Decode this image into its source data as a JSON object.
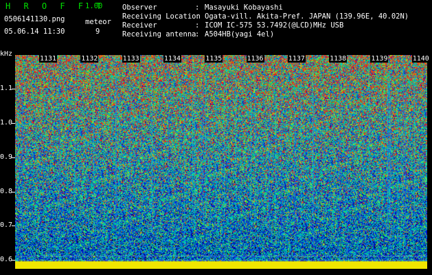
{
  "header": {
    "app_name": "H R O F F T",
    "version": "1.00",
    "filename": "0506141130.png",
    "meteor_label": "meteor",
    "datetime": "05.06.14 11:30",
    "meteor_count": "9"
  },
  "station": {
    "rows": [
      {
        "label": "Observer",
        "value": "Masayuki Kobayashi"
      },
      {
        "label": "Receiving Location",
        "value": "Ogata-vill. Akita-Pref. JAPAN (139.96E, 40.02N)"
      },
      {
        "label": "Receiver",
        "value": "ICOM IC-575 53.7492(@LCD)MHz USB"
      },
      {
        "label": "Receiving antenna",
        "value": "A504HB(yagi 4el)"
      }
    ],
    "separator": ":"
  },
  "spectrogram": {
    "y_unit": "kHz",
    "y_ticks": [
      "1.1",
      "1.0",
      "0.9",
      "0.8",
      "0.7",
      "0.6"
    ],
    "time_labels": [
      "1131",
      "1132",
      "1133",
      "1134",
      "1135",
      "1136",
      "1137",
      "1138",
      "1139",
      "1140"
    ],
    "colors": {
      "background": "#000000",
      "low": "#0000c8",
      "mid": "#00c8c8",
      "high": "#00ff00",
      "peak": "#ff0000",
      "baseline": "#ffff00"
    }
  }
}
